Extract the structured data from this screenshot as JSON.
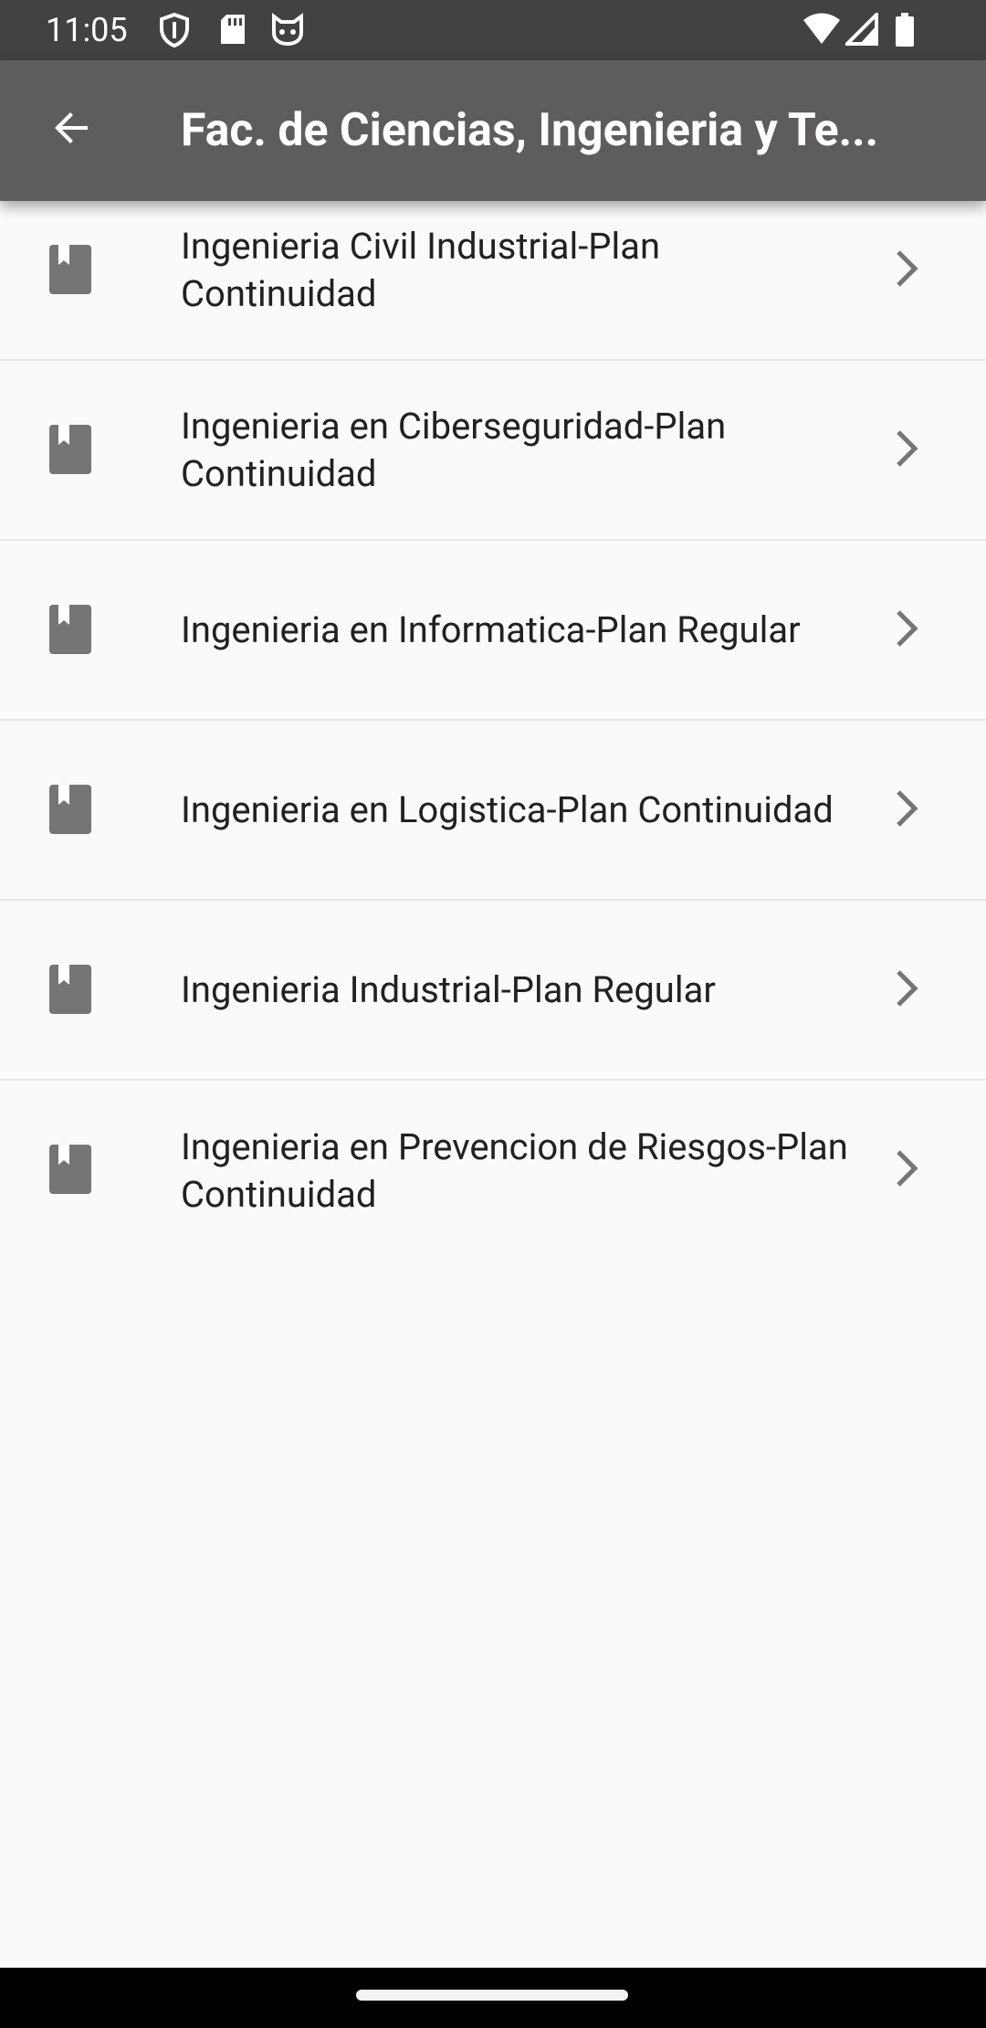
{
  "status_bar": {
    "time": "11:05",
    "icons": [
      "shield-icon",
      "sd-card-icon",
      "cat-icon",
      "wifi-icon",
      "signal-icon",
      "battery-icon"
    ]
  },
  "app_bar": {
    "title": "Fac. de Ciencias, Ingenieria y Te...",
    "back_icon": "arrow-back-icon"
  },
  "list": {
    "items": [
      {
        "label": "Ingenieria Civil Industrial-Plan Continuidad",
        "icon": "book-icon"
      },
      {
        "label": "Ingenieria en Ciberseguridad-Plan Continuidad",
        "icon": "book-icon"
      },
      {
        "label": "Ingenieria en Informatica-Plan Regular",
        "icon": "book-icon"
      },
      {
        "label": "Ingenieria en Logistica-Plan Continuidad",
        "icon": "book-icon"
      },
      {
        "label": "Ingenieria Industrial-Plan Regular",
        "icon": "book-icon"
      },
      {
        "label": "Ingenieria en Prevencion de Riesgos-Plan Continuidad",
        "icon": "book-icon"
      }
    ]
  },
  "colors": {
    "status_bar": "#424242",
    "app_bar": "#5e5c5c",
    "background": "#fafafa",
    "icon_grey": "#757575",
    "text": "#212121",
    "divider": "#e6e6e6"
  }
}
